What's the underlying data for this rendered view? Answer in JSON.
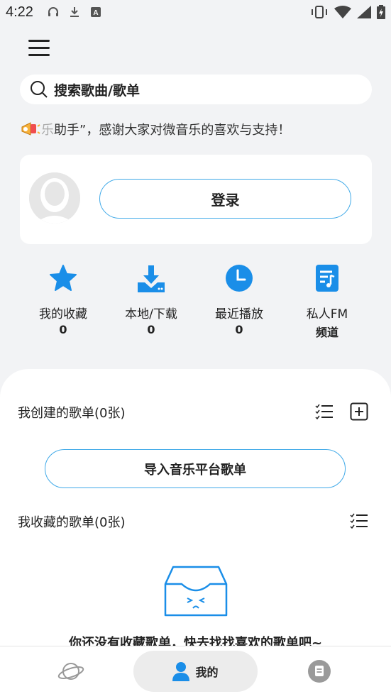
{
  "status_bar": {
    "time": "4:22",
    "left_icons": [
      "headphones-icon",
      "download-icon",
      "a-icon"
    ],
    "right_icons": [
      "vibrate-icon",
      "wifi-icon",
      "signal-icon",
      "battery-icon"
    ]
  },
  "search": {
    "placeholder": "搜索歌曲/歌单"
  },
  "notice": {
    "faded_text": "乐",
    "text": "助手”，感谢大家对微音乐的喜欢与支持！"
  },
  "login": {
    "button_label": "登录"
  },
  "quick_actions": [
    {
      "label": "我的收藏",
      "count": "0",
      "icon": "star-icon"
    },
    {
      "label": "本地/下载",
      "count": "0",
      "icon": "download-icon"
    },
    {
      "label": "最近播放",
      "count": "0",
      "icon": "clock-icon"
    },
    {
      "label": "私人FM",
      "count": "频道",
      "icon": "music-note-icon"
    }
  ],
  "created_playlists": {
    "title": "我创建的歌单(0张)",
    "import_label": "导入音乐平台歌单"
  },
  "collected_playlists": {
    "title": "我收藏的歌单(0张)",
    "empty_text": "你还没有收藏歌单，快去找找喜欢的歌单吧~"
  },
  "bottom_nav": [
    {
      "label": "",
      "icon": "planet-icon"
    },
    {
      "label": "我的",
      "icon": "person-icon"
    },
    {
      "label": "",
      "icon": "message-icon"
    }
  ],
  "colors": {
    "accent": "#1a8ee8",
    "outline": "#3fa9e8",
    "background": "#f2f3f5"
  }
}
